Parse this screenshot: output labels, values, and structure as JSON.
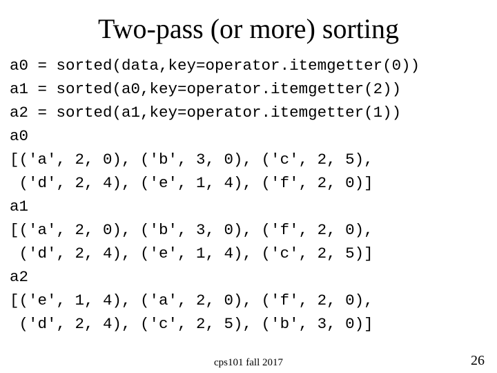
{
  "title": "Two-pass (or more) sorting",
  "code": {
    "l1": "a0 = sorted(data,key=operator.itemgetter(0))",
    "l2": "a1 = sorted(a0,key=operator.itemgetter(2))",
    "l3": "a2 = sorted(a1,key=operator.itemgetter(1))",
    "l4": "a0",
    "l5": "[('a', 2, 0), ('b', 3, 0), ('c', 2, 5),",
    "l6": " ('d', 2, 4), ('e', 1, 4), ('f', 2, 0)]",
    "l7": "a1",
    "l8": "[('a', 2, 0), ('b', 3, 0), ('f', 2, 0),",
    "l9": " ('d', 2, 4), ('e', 1, 4), ('c', 2, 5)]",
    "l10": "a2",
    "l11": "[('e', 1, 4), ('a', 2, 0), ('f', 2, 0),",
    "l12": " ('d', 2, 4), ('c', 2, 5), ('b', 3, 0)]"
  },
  "footer": {
    "center": "cps101 fall 2017",
    "page": "26"
  }
}
